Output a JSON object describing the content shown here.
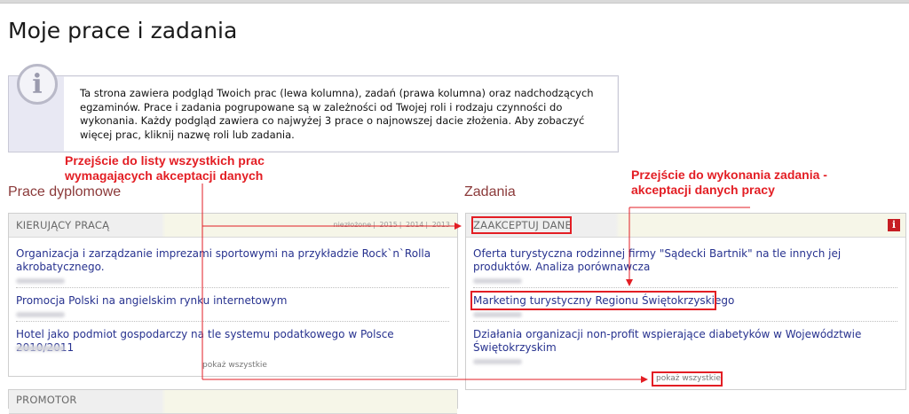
{
  "page": {
    "title": "Moje prace i zadania"
  },
  "info": {
    "text": "Ta strona zawiera podgląd Twoich prac (lewa kolumna), zadań (prawa kolumna) oraz nadchodzących egzaminów. Prace i zadania pogrupowane są w zależności od Twojej roli i rodzaju czynności do wykonania. Każdy podgląd zawiera co najwyżej 3 prace o najnowszej dacie złożenia. Aby zobaczyć więcej prac, kliknij nazwę roli lub zadania."
  },
  "annotations": {
    "left_line1": "Przejście do listy wszystkich prac",
    "left_line2": "wymagających akceptacji danych",
    "right_line1": "Przejście do wykonania zadania -",
    "right_line2": "akceptacji danych pracy"
  },
  "left": {
    "section_title": "Prace dyplomowe",
    "panel_label": "KIERUJĄCY PRACĄ",
    "years": [
      "niezłożone",
      "2015",
      "2014",
      "2013"
    ],
    "items": [
      "Organizacja i zarządzanie imprezami sportowymi na przykładzie Rock`n`Rolla akrobatycznego.",
      "Promocja Polski na angielskim rynku internetowym",
      "Hotel jako podmiot gospodarczy na tle systemu podatkowego w Polsce 2010/2011"
    ],
    "show_all": "pokaż wszystkie",
    "next_panel_label": "PROMOTOR"
  },
  "right": {
    "section_title": "Zadania",
    "panel_label": "ZAAKCEPTUJ DANE",
    "badge": "i",
    "items": [
      "Oferta turystyczna rodzinnej firmy \"Sądecki Bartnik\" na tle innych jej produktów. Analiza porównawcza",
      "Marketing turystyczny Regionu Świętokrzyskiego",
      "Działania organizacji non-profit wspierające diabetyków w Województwie Świętokrzyskim"
    ],
    "show_all": "pokaż wszystkie"
  },
  "colors": {
    "annotation": "#e31e24",
    "link": "#27328f",
    "section_title": "#8b3a3a"
  }
}
